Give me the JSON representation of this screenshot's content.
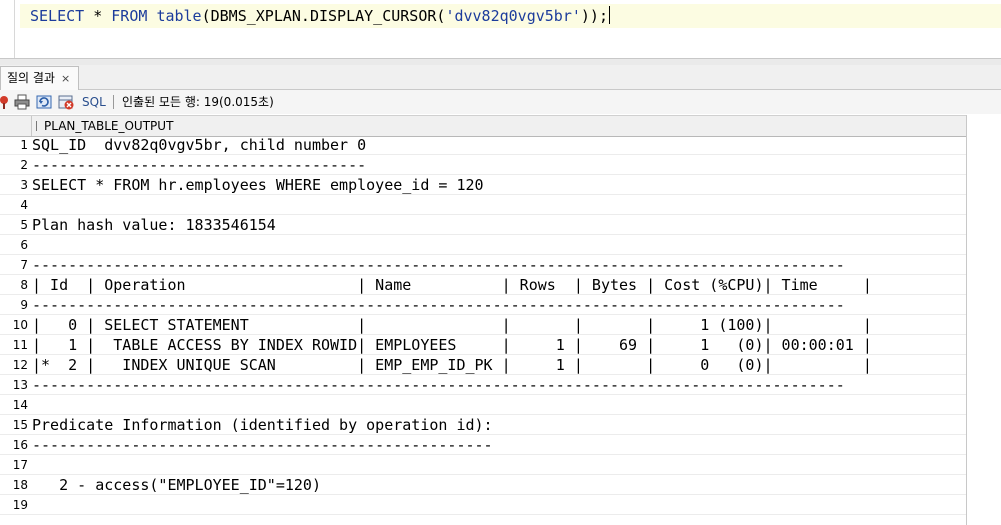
{
  "editor": {
    "kw_select": "SELECT",
    "star": " * ",
    "kw_from": "FROM",
    "space": " ",
    "kw_table": "table",
    "open": "(DBMS_XPLAN.DISPLAY_CURSOR(",
    "literal": "'dvv82q0vgv5br'",
    "close": "));"
  },
  "tab": {
    "label": "질의 결과",
    "close": "×"
  },
  "toolbar": {
    "sql_label": "SQL",
    "status": "인출된 모든 행: 19(0.015초)",
    "icons": [
      "pin-icon",
      "print-icon",
      "refresh-icon",
      "cancel-icon"
    ]
  },
  "grid": {
    "column": "PLAN_TABLE_OUTPUT",
    "rows": [
      {
        "n": "1",
        "text": "SQL_ID  dvv82q0vgv5br, child number 0"
      },
      {
        "n": "2",
        "text": "-------------------------------------"
      },
      {
        "n": "3",
        "text": "SELECT * FROM hr.employees WHERE employee_id = 120"
      },
      {
        "n": "4",
        "text": ""
      },
      {
        "n": "5",
        "text": "Plan hash value: 1833546154"
      },
      {
        "n": "6",
        "text": ""
      },
      {
        "n": "7",
        "text": "------------------------------------------------------------------------------------------"
      },
      {
        "n": "8",
        "text": "| Id  | Operation                   | Name          | Rows  | Bytes | Cost (%CPU)| Time     |"
      },
      {
        "n": "9",
        "text": "------------------------------------------------------------------------------------------"
      },
      {
        "n": "10",
        "text": "|   0 | SELECT STATEMENT            |               |       |       |     1 (100)|          |"
      },
      {
        "n": "11",
        "text": "|   1 |  TABLE ACCESS BY INDEX ROWID| EMPLOYEES     |     1 |    69 |     1   (0)| 00:00:01 |"
      },
      {
        "n": "12",
        "text": "|*  2 |   INDEX UNIQUE SCAN         | EMP_EMP_ID_PK |     1 |       |     0   (0)|          |"
      },
      {
        "n": "13",
        "text": "------------------------------------------------------------------------------------------"
      },
      {
        "n": "14",
        "text": ""
      },
      {
        "n": "15",
        "text": "Predicate Information (identified by operation id):"
      },
      {
        "n": "16",
        "text": "---------------------------------------------------"
      },
      {
        "n": "17",
        "text": ""
      },
      {
        "n": "18",
        "text": "   2 - access(\"EMPLOYEE_ID\"=120)"
      },
      {
        "n": "19",
        "text": ""
      }
    ]
  }
}
